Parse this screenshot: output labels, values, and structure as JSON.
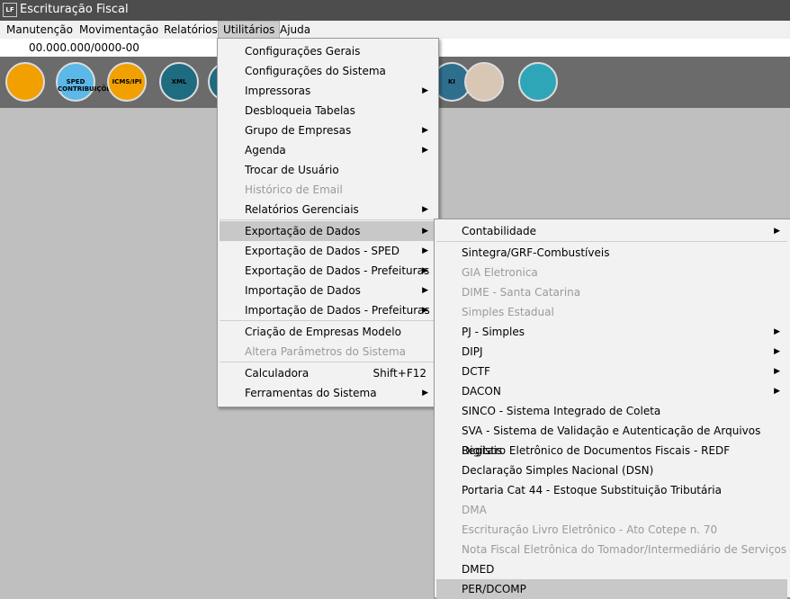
{
  "window": {
    "title": "Escrituração Fiscal",
    "logo_text": "LF"
  },
  "menubar": {
    "items": [
      "Manutenção",
      "Movimentação",
      "Relatórios",
      "Utilitários",
      "Ajuda"
    ],
    "active": "Utilitários"
  },
  "company": {
    "cnpj": "00.000.000/0000-00"
  },
  "toolbar": {
    "icons": [
      {
        "name": "building-icon",
        "label": "",
        "color": "#f2a000"
      },
      {
        "name": "sped-contribuicoes-icon",
        "label": "SPED CONTRIBUIÇÕES",
        "color": "#5bb8e8"
      },
      {
        "name": "icms-ipi-icon",
        "label": "ICMS/IPI",
        "color": "#f2a000"
      },
      {
        "name": "xml-icon",
        "label": "XML",
        "color": "#1f6b80"
      },
      {
        "name": "partial-icon",
        "label": "",
        "color": "#1f6b80"
      },
      {
        "name": "partial-icon-2",
        "label": "KI",
        "color": "#2e6f8e"
      },
      {
        "name": "avatar-icon",
        "label": "",
        "color": "#d9c7b5"
      },
      {
        "name": "gavel-icon",
        "label": "",
        "color": "#2ea6b8"
      }
    ]
  },
  "utilitarios_menu": {
    "items": [
      {
        "label": "Configurações Gerais",
        "disabled": false,
        "submenu": false
      },
      {
        "label": "Configurações do Sistema",
        "disabled": false,
        "submenu": false
      },
      {
        "label": "Impressoras",
        "disabled": false,
        "submenu": true
      },
      {
        "label": "Desbloqueia Tabelas",
        "disabled": false,
        "submenu": false
      },
      {
        "label": "Grupo de Empresas",
        "disabled": false,
        "submenu": true
      },
      {
        "label": "Agenda",
        "disabled": false,
        "submenu": true
      },
      {
        "label": "Trocar de Usuário",
        "disabled": false,
        "submenu": false
      },
      {
        "label": "Histórico de Email",
        "disabled": true,
        "submenu": false
      },
      {
        "label": "Relatórios Gerenciais",
        "disabled": false,
        "submenu": true
      },
      {
        "label": "Exportação de Dados",
        "disabled": false,
        "submenu": true,
        "highlighted": true
      },
      {
        "label": "Exportação de Dados - SPED",
        "disabled": false,
        "submenu": true
      },
      {
        "label": "Exportação de Dados - Prefeituras",
        "disabled": false,
        "submenu": true
      },
      {
        "label": "Importação de Dados",
        "disabled": false,
        "submenu": true
      },
      {
        "label": "Importação de Dados - Prefeituras",
        "disabled": false,
        "submenu": true
      },
      {
        "label": "Criação de Empresas Modelo",
        "disabled": false,
        "submenu": false
      },
      {
        "label": "Altera Parâmetros do Sistema",
        "disabled": true,
        "submenu": false
      },
      {
        "label": "Calculadora",
        "disabled": false,
        "submenu": false,
        "shortcut": "Shift+F12"
      },
      {
        "label": "Ferramentas do Sistema",
        "disabled": false,
        "submenu": true
      }
    ]
  },
  "exportacao_submenu": {
    "items": [
      {
        "label": "Contabilidade",
        "disabled": false,
        "submenu": true
      },
      {
        "label": "Sintegra/GRF-Combustíveis",
        "disabled": false,
        "submenu": false
      },
      {
        "label": "GIA Eletronica",
        "disabled": true,
        "submenu": false
      },
      {
        "label": "DIME - Santa Catarina",
        "disabled": true,
        "submenu": false
      },
      {
        "label": "Simples Estadual",
        "disabled": true,
        "submenu": false
      },
      {
        "label": "PJ - Simples",
        "disabled": false,
        "submenu": true
      },
      {
        "label": "DIPJ",
        "disabled": false,
        "submenu": true
      },
      {
        "label": "DCTF",
        "disabled": false,
        "submenu": true
      },
      {
        "label": "DACON",
        "disabled": false,
        "submenu": true
      },
      {
        "label": "SINCO - Sistema Integrado de Coleta",
        "disabled": false,
        "submenu": false
      },
      {
        "label": "SVA - Sistema de Validação e Autenticação de Arquivos Digitais",
        "disabled": false,
        "submenu": false
      },
      {
        "label": "Registro Eletrônico de Documentos Fiscais - REDF",
        "disabled": false,
        "submenu": false
      },
      {
        "label": "Declaração Simples Nacional (DSN)",
        "disabled": false,
        "submenu": false
      },
      {
        "label": "Portaria Cat 44 - Estoque Substituição Tributária",
        "disabled": false,
        "submenu": false
      },
      {
        "label": "DMA",
        "disabled": true,
        "submenu": false
      },
      {
        "label": "Escrituração Livro Eletrônico - Ato Cotepe n. 70",
        "disabled": true,
        "submenu": false
      },
      {
        "label": "Nota Fiscal Eletrônica do Tomador/Intermediário de Serviços",
        "disabled": true,
        "submenu": false
      },
      {
        "label": "DMED",
        "disabled": false,
        "submenu": false
      },
      {
        "label": "PER/DCOMP",
        "disabled": false,
        "submenu": false,
        "highlighted": true
      }
    ]
  }
}
